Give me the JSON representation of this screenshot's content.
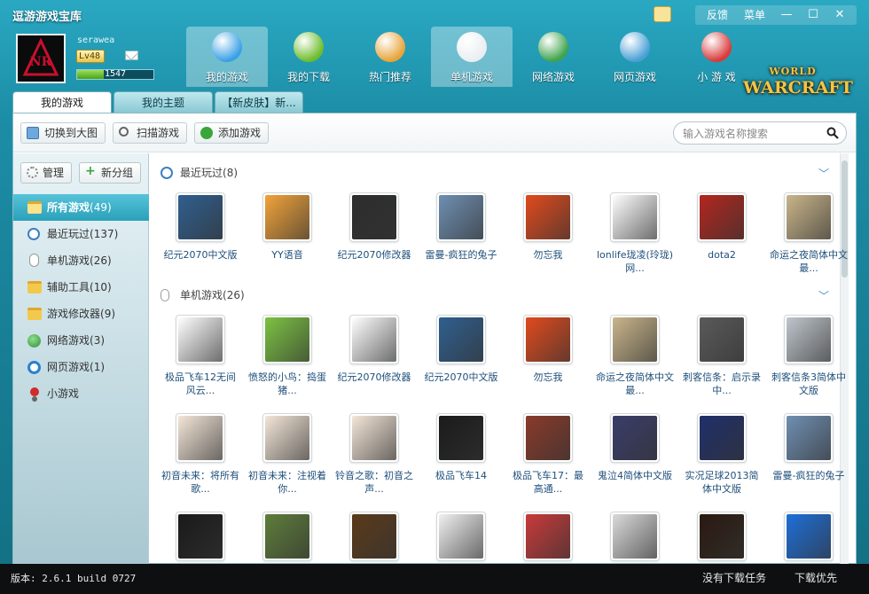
{
  "app": {
    "title": "逗游游戏宝库"
  },
  "title_controls": {
    "feedback": "反馈",
    "menu": "菜单",
    "minimize_glyph": "—",
    "maximize_glyph": "☐",
    "close_glyph": "✕"
  },
  "user": {
    "name": "serawea",
    "level": "Lv48",
    "exp": "1547"
  },
  "main_nav": [
    {
      "label": "我的游戏",
      "icon": "user-game-icon",
      "color": "#3aa0e6"
    },
    {
      "label": "我的下载",
      "icon": "download-gear-icon",
      "color": "#6dbd2c"
    },
    {
      "label": "热门推荐",
      "icon": "disc-plus-icon",
      "color": "#e8a43a"
    },
    {
      "label": "单机游戏",
      "icon": "gamepad-icon",
      "color": "#e9eef1"
    },
    {
      "label": "网络游戏",
      "icon": "globe-icon",
      "color": "#3fa34d"
    },
    {
      "label": "网页游戏",
      "icon": "browser-icon",
      "color": "#4aa0d6"
    },
    {
      "label": "小 游 戏",
      "icon": "joystick-icon",
      "color": "#d93a3a"
    }
  ],
  "logo": {
    "line1": "WORLD",
    "line2": "WARCRAFT"
  },
  "tabs": [
    "我的游戏",
    "我的主题",
    "【新皮肤】新..."
  ],
  "toolbar": {
    "switch_big": "切换到大图",
    "scan": "扫描游戏",
    "add": "添加游戏"
  },
  "search": {
    "placeholder": "输入游戏名称搜索"
  },
  "sidebar": {
    "manage": "管理",
    "new_group": "新分组",
    "items": [
      {
        "label": "所有游戏",
        "count": "(49)"
      },
      {
        "label": "最近玩过",
        "count": "(137)"
      },
      {
        "label": "单机游戏",
        "count": "(26)"
      },
      {
        "label": "辅助工具",
        "count": "(10)"
      },
      {
        "label": "游戏修改器",
        "count": "(9)"
      },
      {
        "label": "网络游戏",
        "count": "(3)"
      },
      {
        "label": "网页游戏",
        "count": "(1)"
      },
      {
        "label": "小游戏",
        "count": ""
      }
    ]
  },
  "sections": [
    {
      "title": "最近玩过",
      "count": "(8)",
      "games": [
        {
          "name": "纪元2070中文版",
          "color": "#2f5f8f"
        },
        {
          "name": "YY语音",
          "color": "#f2a33a"
        },
        {
          "name": "纪元2070修改器",
          "color": "#2d2d2d"
        },
        {
          "name": "雷曼-疯狂的兔子",
          "color": "#6f8fb2"
        },
        {
          "name": "勿忘我",
          "color": "#e14a1d"
        },
        {
          "name": "lonlife珑凌(玲珑)网...",
          "color": "#ffffff"
        },
        {
          "name": "dota2",
          "color": "#b3261e"
        },
        {
          "name": "命运之夜简体中文最...",
          "color": "#c9b58a"
        }
      ]
    },
    {
      "title": "单机游戏",
      "count": "(26)",
      "games": [
        {
          "name": "极品飞车12无间风云...",
          "color": "#ffffff"
        },
        {
          "name": "愤怒的小鸟：捣蛋猪...",
          "color": "#7cc242"
        },
        {
          "name": "纪元2070修改器",
          "color": "#ffffff"
        },
        {
          "name": "纪元2070中文版",
          "color": "#2f5f8f"
        },
        {
          "name": "勿忘我",
          "color": "#e14a1d"
        },
        {
          "name": "命运之夜简体中文最...",
          "color": "#c9b58a"
        },
        {
          "name": "刺客信条：启示录中...",
          "color": "#5a5a5a"
        },
        {
          "name": "刺客信条3简体中文版",
          "color": "#bfc6cc"
        },
        {
          "name": "初音未来：将所有歌...",
          "color": "#f4e6d8"
        },
        {
          "name": "初音未来：注视着你...",
          "color": "#f4e6d8"
        },
        {
          "name": "铃音之歌：初音之声...",
          "color": "#f4e6d8"
        },
        {
          "name": "极品飞车14",
          "color": "#1b1b1b"
        },
        {
          "name": "极品飞车17：最高通...",
          "color": "#8a3a2a"
        },
        {
          "name": "鬼泣4简体中文版",
          "color": "#3a3d6a"
        },
        {
          "name": "实况足球2013简体中文版",
          "color": "#1f2f6a"
        },
        {
          "name": "雷曼-疯狂的兔子",
          "color": "#6f8fb2"
        },
        {
          "name": "",
          "color": "#1a1a1a"
        },
        {
          "name": "",
          "color": "#5e7d3a"
        },
        {
          "name": "",
          "color": "#5a3a1a"
        },
        {
          "name": "",
          "color": "#f0f0f0"
        },
        {
          "name": "",
          "color": "#c93a3a"
        },
        {
          "name": "",
          "color": "#dadada"
        },
        {
          "name": "",
          "color": "#2a1a10"
        },
        {
          "name": "",
          "color": "#1e6fd9"
        }
      ]
    }
  ],
  "status": {
    "version": "版本: 2.6.1 build 0727",
    "tasks": "没有下载任务",
    "priority": "下载优先"
  }
}
